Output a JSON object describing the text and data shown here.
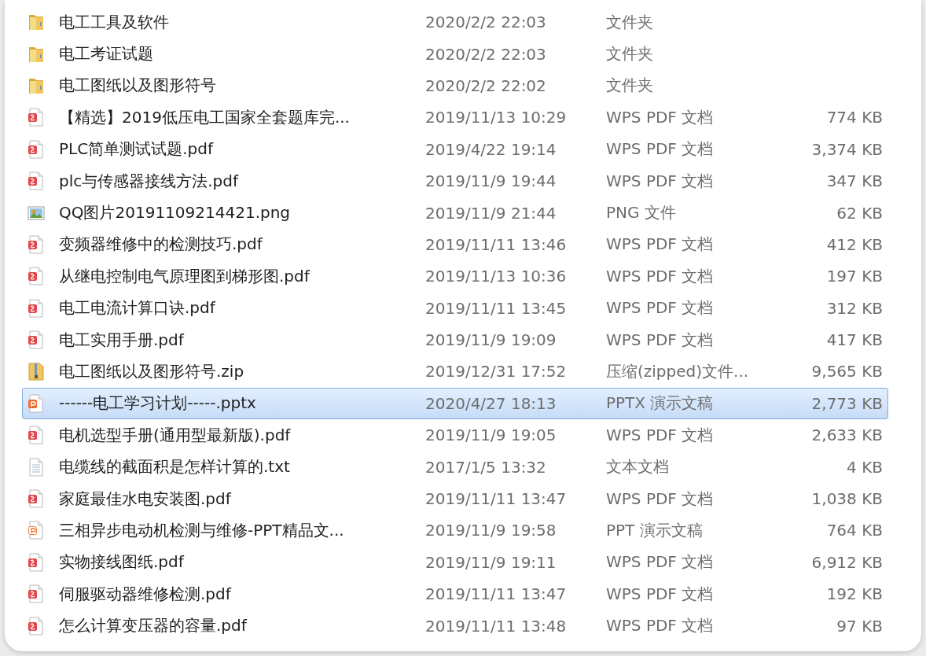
{
  "files": [
    {
      "name": "电工工具及软件",
      "date": "2020/2/2 22:03",
      "type": "文件夹",
      "kind": "folder",
      "selected": false
    },
    {
      "name": "电工考证试题",
      "date": "2020/2/2 22:03",
      "type": "文件夹",
      "kind": "folder",
      "selected": false
    },
    {
      "name": "电工图纸以及图形符号",
      "date": "2020/2/2 22:02",
      "type": "文件夹",
      "kind": "folder",
      "selected": false
    },
    {
      "name": "【精选】2019低压电工国家全套题库完...",
      "date": "2019/11/13 10:29",
      "type": "WPS PDF 文档",
      "size": "774 KB",
      "kind": "pdf",
      "selected": false
    },
    {
      "name": "PLC简单测试试题.pdf",
      "date": "2019/4/22 19:14",
      "type": "WPS PDF 文档",
      "size": "3,374 KB",
      "kind": "pdf",
      "selected": false
    },
    {
      "name": "plc与传感器接线方法.pdf",
      "date": "2019/11/9 19:44",
      "type": "WPS PDF 文档",
      "size": "347 KB",
      "kind": "pdf",
      "selected": false
    },
    {
      "name": "QQ图片20191109214421.png",
      "date": "2019/11/9 21:44",
      "type": "PNG 文件",
      "size": "62 KB",
      "kind": "image",
      "selected": false
    },
    {
      "name": "变频器维修中的检测技巧.pdf",
      "date": "2019/11/11 13:46",
      "type": "WPS PDF 文档",
      "size": "412 KB",
      "kind": "pdf",
      "selected": false
    },
    {
      "name": "从继电控制电气原理图到梯形图.pdf",
      "date": "2019/11/13 10:36",
      "type": "WPS PDF 文档",
      "size": "197 KB",
      "kind": "pdf",
      "selected": false
    },
    {
      "name": "电工电流计算口诀.pdf",
      "date": "2019/11/11 13:45",
      "type": "WPS PDF 文档",
      "size": "312 KB",
      "kind": "pdf",
      "selected": false
    },
    {
      "name": "电工实用手册.pdf",
      "date": "2019/11/9 19:09",
      "type": "WPS PDF 文档",
      "size": "417 KB",
      "kind": "pdf",
      "selected": false
    },
    {
      "name": "电工图纸以及图形符号.zip",
      "date": "2019/12/31 17:52",
      "type": "压缩(zipped)文件...",
      "size": "9,565 KB",
      "kind": "zip",
      "selected": false
    },
    {
      "name": "------电工学习计划-----.pptx",
      "date": "2020/4/27 18:13",
      "type": "PPTX 演示文稿",
      "size": "2,773 KB",
      "kind": "pptx",
      "selected": true
    },
    {
      "name": "电机选型手册(通用型最新版).pdf",
      "date": "2019/11/9 19:05",
      "type": "WPS PDF 文档",
      "size": "2,633 KB",
      "kind": "pdf",
      "selected": false
    },
    {
      "name": "电缆线的截面积是怎样计算的.txt",
      "date": "2017/1/5 13:32",
      "type": "文本文档",
      "size": "4 KB",
      "kind": "text",
      "selected": false
    },
    {
      "name": "家庭最佳水电安装图.pdf",
      "date": "2019/11/11 13:47",
      "type": "WPS PDF 文档",
      "size": "1,038 KB",
      "kind": "pdf",
      "selected": false
    },
    {
      "name": "三相异步电动机检测与维修-PPT精品文...",
      "date": "2019/11/9 19:58",
      "type": "PPT 演示文稿",
      "size": "764 KB",
      "kind": "ppt",
      "selected": false
    },
    {
      "name": "实物接线图纸.pdf",
      "date": "2019/11/9 19:11",
      "type": "WPS PDF 文档",
      "size": "6,912 KB",
      "kind": "pdf",
      "selected": false
    },
    {
      "name": "伺服驱动器维修检测.pdf",
      "date": "2019/11/11 13:47",
      "type": "WPS PDF 文档",
      "size": "192 KB",
      "kind": "pdf",
      "selected": false
    },
    {
      "name": "怎么计算变压器的容量.pdf",
      "date": "2019/11/11 13:48",
      "type": "WPS PDF 文档",
      "size": "97 KB",
      "kind": "pdf",
      "selected": false
    }
  ]
}
